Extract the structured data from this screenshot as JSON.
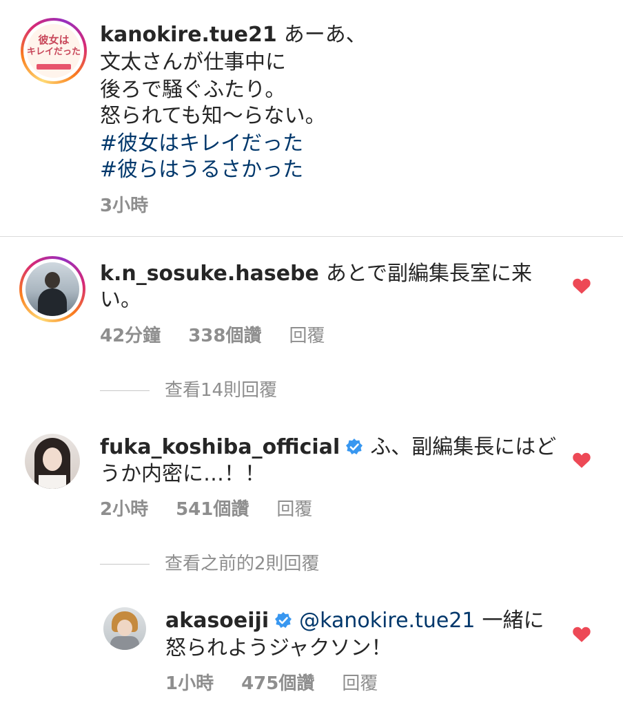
{
  "post": {
    "username": "kanokire.tue21",
    "avatar_text": [
      "彼女は",
      "キレイだった"
    ],
    "lines": [
      "あーあ、",
      "文太さんが仕事中に",
      "後ろで騒ぐふたり。",
      "怒られても知〜らない。"
    ],
    "hashtags": [
      "#彼女はキレイだった",
      "#彼らはうるさかった"
    ],
    "time": "3小時"
  },
  "comments": [
    {
      "username": "k.n_sosuke.hasebe",
      "text_line1": "あとで副編集長室に来",
      "text_line2": "い。",
      "time": "42分鐘",
      "likes": "338個讚",
      "reply_label": "回覆",
      "view_replies": "查看14則回覆"
    },
    {
      "username": "fuka_koshiba_official",
      "verified": true,
      "text_line1": "ふ、副編集長にはど",
      "text_line2": "うか内密に…！！",
      "time": "2小時",
      "likes": "541個讚",
      "reply_label": "回覆",
      "view_replies": "查看之前的2則回覆"
    }
  ],
  "reply": {
    "username": "akasoeiji",
    "verified": true,
    "mention": "@kanokire.tue21",
    "text_line1": "一緒に",
    "text_line2": "怒られようジャクソン！",
    "time": "1小時",
    "likes": "475個讚",
    "reply_label": "回覆"
  },
  "colors": {
    "heart": "#ed4956",
    "link": "#00376b",
    "verified": "#3897f0",
    "meta": "#8e8e8e"
  }
}
